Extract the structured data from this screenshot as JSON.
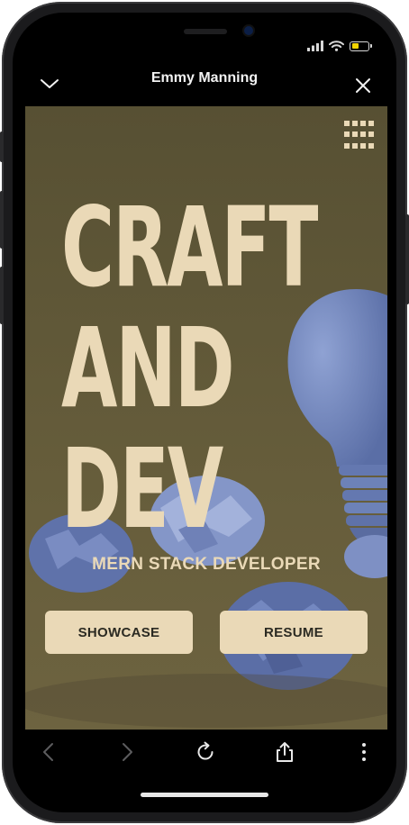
{
  "header": {
    "title": "Emmy Manning"
  },
  "hero": {
    "headline_lines": [
      "CRAFT",
      "AND",
      "DEV"
    ],
    "subtitle": "MERN STACK DEVELOPER",
    "buttons": {
      "showcase": "SHOWCASE",
      "resume": "RESUME"
    }
  },
  "colors": {
    "background": "#5b5437",
    "accent": "#ead9b7",
    "button_text": "#2b2a22",
    "bulb": "#7489bf"
  },
  "icons": {
    "top_left": "chevron-down-icon",
    "top_right": "close-icon",
    "menu": "grid-menu-icon",
    "bottom": [
      "back-icon",
      "forward-icon",
      "reload-icon",
      "share-icon",
      "more-icon"
    ]
  }
}
